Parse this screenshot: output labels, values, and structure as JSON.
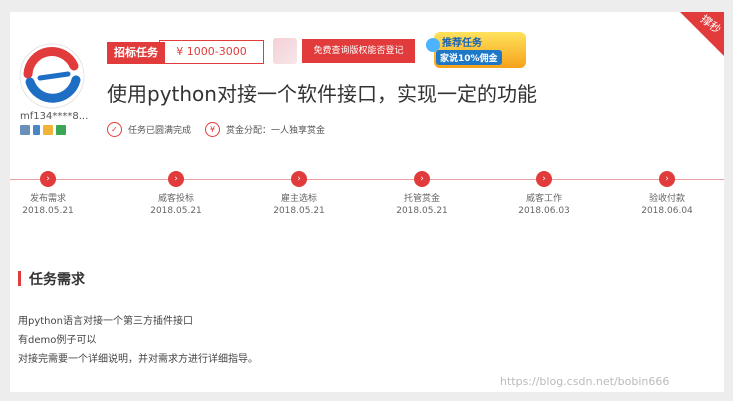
{
  "ribbon": {
    "text": "撑秒"
  },
  "employer": {
    "username": "mf134****8..."
  },
  "tags": {
    "type": "招标任务",
    "price": "¥ 1000-3000",
    "check_button": "免费查询版权能否登记"
  },
  "promo": {
    "line1": "推荐任务",
    "line2": "家说10%佣金"
  },
  "task": {
    "title": "使用python对接一个软件接口，实现一定的功能",
    "status_icon": "✓",
    "status": "任务已圆满完成",
    "reward_icon": "¥",
    "reward": "赏金分配：一人独享赏金"
  },
  "timeline": [
    {
      "label": "发布需求",
      "date": "2018.05.21"
    },
    {
      "label": "威客投标",
      "date": "2018.05.21"
    },
    {
      "label": "雇主选标",
      "date": "2018.05.21"
    },
    {
      "label": "托管赏金",
      "date": "2018.05.21"
    },
    {
      "label": "威客工作",
      "date": "2018.06.03"
    },
    {
      "label": "验收付款",
      "date": "2018.06.04"
    }
  ],
  "requirements": {
    "heading": "任务需求",
    "lines": [
      "用python语言对接一个第三方插件接口",
      "有demo例子可以",
      "对接完需要一个详细说明，并对需求方进行详细指导。"
    ]
  },
  "watermark": "https://blog.csdn.net/bobin666",
  "colors": {
    "accent": "#e23b3b",
    "logo_blue": "#1e6fc4",
    "logo_red": "#e23b3b"
  }
}
